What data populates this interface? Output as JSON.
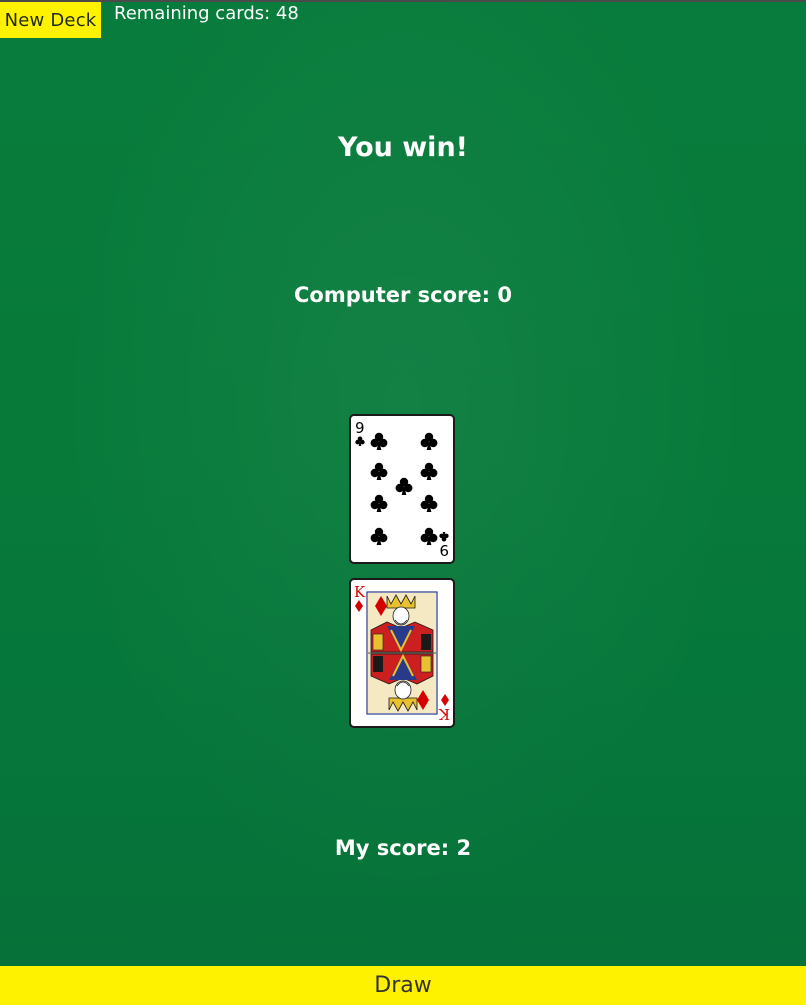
{
  "header": {
    "new_deck_label": "New Deck",
    "remaining_label": "Remaining cards: 48"
  },
  "game": {
    "result_text": "You win!",
    "computer_score_label": "Computer score: 0",
    "my_score_label": "My score: 2"
  },
  "cards": {
    "computer_card": {
      "rank": "9",
      "suit": "clubs",
      "suit_icon": "club-icon",
      "color": "#000000"
    },
    "player_card": {
      "rank": "K",
      "suit": "diamonds",
      "suit_icon": "diamond-icon",
      "color": "#d40000"
    }
  },
  "footer": {
    "draw_label": "Draw"
  },
  "colors": {
    "felt": "#077a3a",
    "button_yellow": "#fff200"
  }
}
